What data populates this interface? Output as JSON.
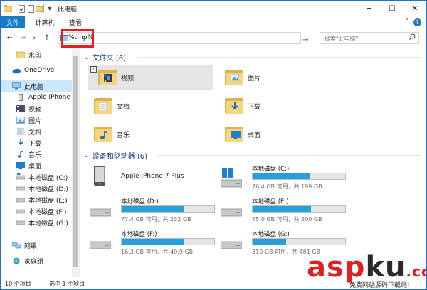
{
  "titlebar": {
    "title": "此电脑",
    "minimize": "─",
    "maximize": "☐",
    "close": "✕",
    "qa_icons": [
      "check-icon",
      "document-icon",
      "folder-icon"
    ],
    "qa_dropdown": "▾"
  },
  "ribbon": {
    "tabs": [
      "文件",
      "计算机",
      "查看"
    ],
    "collapse": "˄",
    "help": "?"
  },
  "nav": {
    "back": "←",
    "forward": "→",
    "recent": "▾",
    "up": "↑",
    "address_value": "%tmp%",
    "go": "→",
    "search_placeholder": "搜索\"此电脑\"",
    "search_icon": "search-icon"
  },
  "sidebar": {
    "items": [
      {
        "label": "水印",
        "icon": "folder-icon"
      },
      {
        "label": "OneDrive",
        "icon": "cloud-icon"
      },
      {
        "label": "此电脑",
        "icon": "computer-icon",
        "selected": true
      },
      {
        "label": "Apple iPhone 7",
        "icon": "phone-icon"
      },
      {
        "label": "视频",
        "icon": "video-icon"
      },
      {
        "label": "图片",
        "icon": "picture-icon"
      },
      {
        "label": "文档",
        "icon": "document-icon"
      },
      {
        "label": "下载",
        "icon": "download-icon"
      },
      {
        "label": "音乐",
        "icon": "music-icon"
      },
      {
        "label": "桌面",
        "icon": "desktop-icon"
      },
      {
        "label": "本地磁盘 (C:)",
        "icon": "drive-icon"
      },
      {
        "label": "本地磁盘 (D:)",
        "icon": "drive-icon"
      },
      {
        "label": "本地磁盘 (E:)",
        "icon": "drive-icon"
      },
      {
        "label": "本地磁盘 (F:)",
        "icon": "drive-icon"
      },
      {
        "label": "本地磁盘 (G:)",
        "icon": "drive-icon"
      },
      {
        "label": "网络",
        "icon": "network-icon"
      },
      {
        "label": "家庭组",
        "icon": "homegroup-icon"
      }
    ]
  },
  "folders_section": {
    "title": "文件夹 (6)",
    "items": [
      {
        "label": "视频",
        "icon": "video-folder-icon"
      },
      {
        "label": "图片",
        "icon": "picture-folder-icon"
      },
      {
        "label": "文档",
        "icon": "document-folder-icon"
      },
      {
        "label": "下载",
        "icon": "download-folder-icon"
      },
      {
        "label": "音乐",
        "icon": "music-folder-icon"
      },
      {
        "label": "桌面",
        "icon": "desktop-folder-icon"
      }
    ]
  },
  "devices_section": {
    "title": "设备和驱动器 (6)",
    "items": [
      {
        "name": "Apple iPhone 7 Plus",
        "icon": "phone-device-icon"
      },
      {
        "name": "本地磁盘 (C:)",
        "info": "76.4 GB 可用，共 199 GB",
        "used": 0.62,
        "icon": "windows-drive-icon"
      },
      {
        "name": "本地磁盘 (D:)",
        "info": "77.4 GB 可用，共 232 GB",
        "used": 0.67,
        "icon": "drive-icon"
      },
      {
        "name": "本地磁盘 (E:)",
        "info": "75.0 GB 可用，共 200 GB",
        "used": 0.63,
        "icon": "drive-icon"
      },
      {
        "name": "本地磁盘 (F:)",
        "info": "16.3 GB 可用，共 49.9 GB",
        "used": 0.67,
        "icon": "drive-icon"
      },
      {
        "name": "本地磁盘 (G:)",
        "info": "310 GB 可用，共 481 GB",
        "used": 0.36,
        "icon": "drive-icon"
      }
    ]
  },
  "status": {
    "count": "10 个项目",
    "selected": "选中 1 个项目"
  },
  "watermark": {
    "main_a": "asp",
    "main_b": "ku",
    "main_c": ".com",
    "sub": "免费网站源码下载站!"
  },
  "colors": {
    "accent": "#1979ca",
    "drive_bar": "#26a0da",
    "highlight": "#e5e5e5",
    "selected": "#cce8ff",
    "red_box": "#e51e1e"
  }
}
